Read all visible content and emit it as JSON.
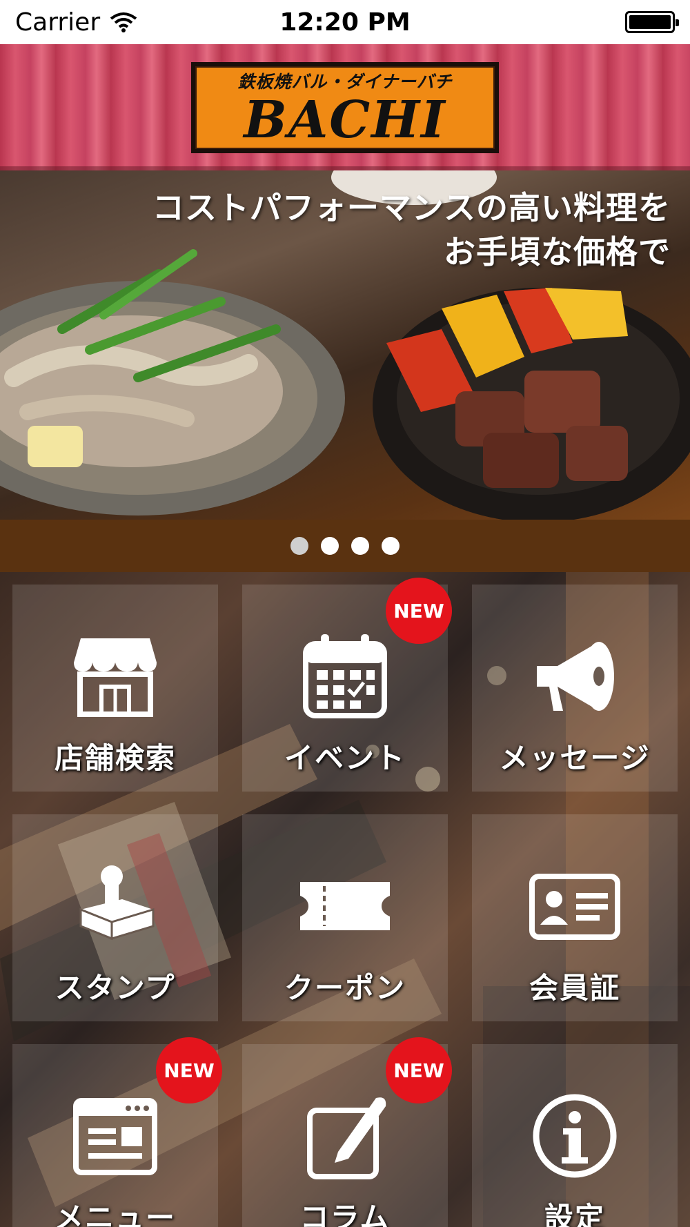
{
  "status_bar": {
    "carrier": "Carrier",
    "time": "12:20 PM"
  },
  "header": {
    "logo_subtitle": "鉄板焼バル・ダイナーバチ",
    "logo_title": "BACHI"
  },
  "hero": {
    "line1": "コストパフォーマンスの高い料理を",
    "line2": "お手頃な価格で",
    "page_count": 4,
    "active_page": 1
  },
  "menu": {
    "badge": "NEW",
    "items": [
      {
        "label": "店舗検索",
        "icon": "store-icon",
        "new": false
      },
      {
        "label": "イベント",
        "icon": "calendar-icon",
        "new": true
      },
      {
        "label": "メッセージ",
        "icon": "megaphone-icon",
        "new": false
      },
      {
        "label": "スタンプ",
        "icon": "stamp-icon",
        "new": false
      },
      {
        "label": "クーポン",
        "icon": "ticket-icon",
        "new": false
      },
      {
        "label": "会員証",
        "icon": "member-card-icon",
        "new": false
      },
      {
        "label": "メニュー",
        "icon": "menu-icon",
        "new": true
      },
      {
        "label": "コラム",
        "icon": "column-pen-icon",
        "new": true
      },
      {
        "label": "設定",
        "icon": "info-icon",
        "new": false
      }
    ]
  },
  "colors": {
    "header": "#c9455f",
    "logo": "#f08a14",
    "pager": "#5a3210",
    "badge": "#e4141c"
  }
}
